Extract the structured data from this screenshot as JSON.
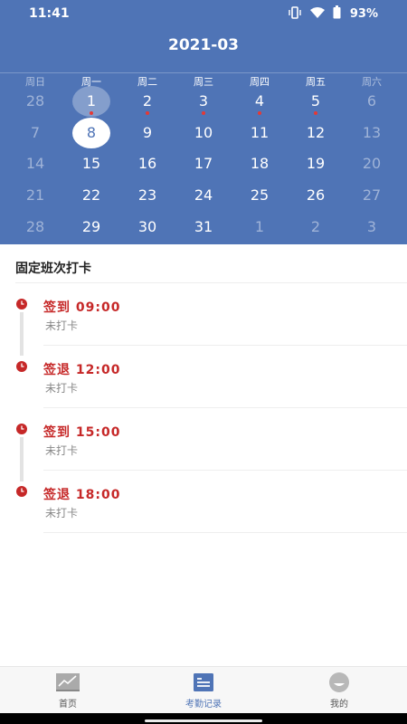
{
  "status": {
    "time": "11:41",
    "battery": "93%"
  },
  "calendar": {
    "month": "2021-03",
    "weekdays": [
      "周日",
      "周一",
      "周二",
      "周三",
      "周四",
      "周五",
      "周六"
    ],
    "weeks": [
      [
        {
          "d": "28",
          "dim": true
        },
        {
          "d": "1",
          "highlight": true,
          "dot": true
        },
        {
          "d": "2",
          "dot": true
        },
        {
          "d": "3",
          "dot": true
        },
        {
          "d": "4",
          "dot": true
        },
        {
          "d": "5",
          "dot": true
        },
        {
          "d": "6",
          "dim": true
        }
      ],
      [
        {
          "d": "7",
          "dim": true
        },
        {
          "d": "8",
          "selected": true
        },
        {
          "d": "9"
        },
        {
          "d": "10"
        },
        {
          "d": "11"
        },
        {
          "d": "12"
        },
        {
          "d": "13",
          "dim": true
        }
      ],
      [
        {
          "d": "14",
          "dim": true
        },
        {
          "d": "15"
        },
        {
          "d": "16"
        },
        {
          "d": "17"
        },
        {
          "d": "18"
        },
        {
          "d": "19"
        },
        {
          "d": "20",
          "dim": true
        }
      ],
      [
        {
          "d": "21",
          "dim": true
        },
        {
          "d": "22"
        },
        {
          "d": "23"
        },
        {
          "d": "24"
        },
        {
          "d": "25"
        },
        {
          "d": "26"
        },
        {
          "d": "27",
          "dim": true
        }
      ],
      [
        {
          "d": "28",
          "dim": true
        },
        {
          "d": "29"
        },
        {
          "d": "30"
        },
        {
          "d": "31"
        },
        {
          "d": "1",
          "dim": true
        },
        {
          "d": "2",
          "dim": true
        },
        {
          "d": "3",
          "dim": true
        }
      ]
    ]
  },
  "section_title": "固定班次打卡",
  "records": [
    {
      "label": "签到",
      "time": "09:00",
      "status": "未打卡"
    },
    {
      "label": "签退",
      "time": "12:00",
      "status": "未打卡"
    },
    {
      "label": "签到",
      "time": "15:00",
      "status": "未打卡"
    },
    {
      "label": "签退",
      "time": "18:00",
      "status": "未打卡"
    }
  ],
  "tabs": [
    {
      "label": "首页",
      "icon": "chart-icon"
    },
    {
      "label": "考勤记录",
      "icon": "document-list-icon",
      "active": true
    },
    {
      "label": "我的",
      "icon": "profile-icon"
    }
  ],
  "colors": {
    "primary": "#4f74b6",
    "accent_red": "#c62828",
    "dot_red": "#e53935"
  }
}
